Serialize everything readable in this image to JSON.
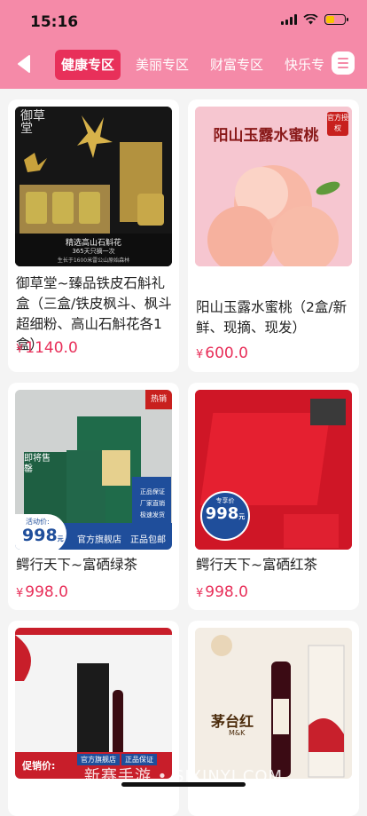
{
  "status_bar": {
    "time": "15:16"
  },
  "tabs": [
    {
      "label": "健康专区",
      "active": true
    },
    {
      "label": "美丽专区",
      "active": false
    },
    {
      "label": "财富专区",
      "active": false
    },
    {
      "label": "快乐专",
      "active": false
    }
  ],
  "products": [
    {
      "title": "御草堂~臻品铁皮石斛礼盒（三盒/铁皮枫斗、枫斗超细粉、高山石斛花各1盒）",
      "price": "1140.0",
      "image": {
        "brand_text": "御草堂",
        "banner_line1": "精选高山石斛花",
        "banner_line2": "365天只摘一次",
        "banner_line3": "生长于1600米雷公山原始森林"
      }
    },
    {
      "title": "阳山玉露水蜜桃（2盒/新鲜、现摘、现发）",
      "price": "600.0",
      "image": {
        "heading": "阳山玉露水蜜桃",
        "stamp": "官方授权"
      }
    },
    {
      "title": "鳄行天下~富硒绿茶",
      "price": "998.0",
      "image": {
        "corner_tag": "热销",
        "soon": "即将售罄",
        "promo_label": "活动价:",
        "promo_price": "998",
        "promo_unit": "元",
        "store": "官方旗舰店",
        "shipping": "正品包邮",
        "perks": [
          "正品保证",
          "厂家直销",
          "极速发货"
        ]
      }
    },
    {
      "title": "鳄行天下~富硒红茶",
      "price": "998.0",
      "image": {
        "promo_label": "专享价",
        "promo_price": "998",
        "promo_unit": "元"
      }
    },
    {
      "title": "",
      "price": "",
      "image": {
        "promo_label": "促销价:",
        "store": "官方旗舰店",
        "quality": "正品保证"
      }
    },
    {
      "title": "",
      "price": "",
      "image": {
        "brand": "茅台红",
        "sub": "M&K"
      }
    }
  ],
  "currency": "¥",
  "watermark": "新赛手游 • SIXINYI.COM",
  "colors": {
    "header": "#f58aa8",
    "accent": "#e8305a"
  }
}
